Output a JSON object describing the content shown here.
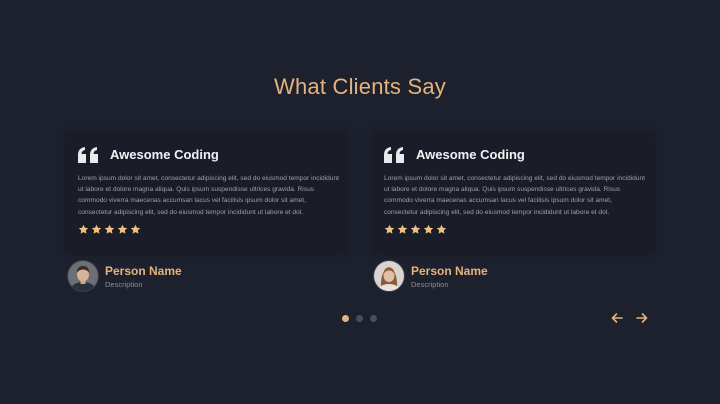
{
  "section": {
    "title": "What Clients Say"
  },
  "colors": {
    "background": "#1d212d",
    "card": "#1a1d28",
    "accent": "#e6b27e",
    "star": "#f0c27e",
    "dot_inactive": "#4a4e5a"
  },
  "testimonials": [
    {
      "title": "Awesome Coding",
      "quote_icon": "quote-icon",
      "text": "Lorem ipsum dolor sit amet, consectetur adipiscing elit, sed do eiusmod tempor incididunt ut labore et dolore magna aliqua. Quis ipsum suspendisse ultrices gravida. Risus commodo viverra maecenas accumsan lacus vel facilisis ipsum dolor sit amet, consectetur adipiscing elit, sed do eiusmod tempor incididunt ut labore et dol.",
      "rating": 5,
      "person_name": "Person Name",
      "person_description": "Description"
    },
    {
      "title": "Awesome Coding",
      "quote_icon": "quote-icon",
      "text": "Lorem ipsum dolor sit amet, consectetur adipiscing elit, sed do eiusmod tempor incididunt ut labore et dolore magna aliqua. Quis ipsum suspendisse ultrices gravida. Risus commodo viverra maecenas accumsan lacus vel facilisis ipsum dolor sit amet, consectetur adipiscing elit, sed do eiusmod tempor incididunt ut labore et dol.",
      "rating": 5,
      "person_name": "Person Name",
      "person_description": "Description"
    }
  ],
  "pagination": {
    "total": 3,
    "active": 1
  },
  "navigation": {
    "prev_icon": "arrow-left-icon",
    "next_icon": "arrow-right-icon"
  }
}
